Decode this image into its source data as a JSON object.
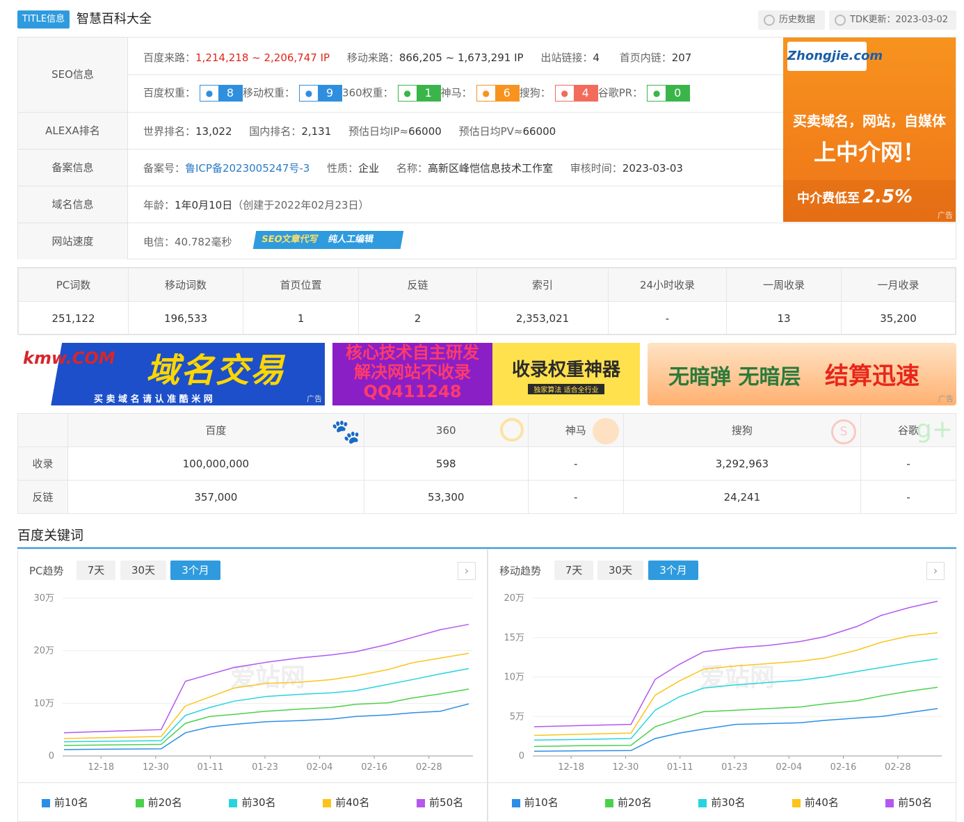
{
  "header": {
    "tag": "TITLE信息",
    "site_name": "智慧百科大全",
    "history_label": "历史数据",
    "tdk_label": "TDK更新：2023-03-02"
  },
  "seo": {
    "row_labels": [
      "SEO信息",
      "ALEXA排名",
      "备案信息",
      "域名信息",
      "网站速度"
    ],
    "baidu_source_k": "百度来路：",
    "baidu_source_v": "1,214,218 ~ 2,206,747 IP",
    "mobile_source_k": "移动来路：",
    "mobile_source_v": "866,205 ~ 1,673,291 IP",
    "out_links_k": "出站链接：",
    "out_links_v": "4",
    "home_links_k": "首页内链：",
    "home_links_v": "207",
    "weights": [
      {
        "k": "百度权重：",
        "v": "8",
        "icon": "paw-icon",
        "color": "#2f8fde"
      },
      {
        "k": "移动权重：",
        "v": "9",
        "icon": "paw-icon",
        "color": "#2f8fde"
      },
      {
        "k": "360权重：",
        "v": "1",
        "icon": "360-icon",
        "color": "#3ab54a"
      },
      {
        "k": "神马：",
        "v": "6",
        "icon": "shenma-icon",
        "color": "#f7931e"
      },
      {
        "k": "搜狗：",
        "v": "4",
        "icon": "sogou-icon",
        "color": "#f26b5b"
      },
      {
        "k": "谷歌PR：",
        "v": "0",
        "icon": "google-plus-icon",
        "color": "#3ab54a"
      }
    ],
    "alexa": {
      "world_k": "世界排名：",
      "world_v": "13,022",
      "cn_k": "国内排名：",
      "cn_v": "2,131",
      "ip_k": "预估日均IP≈",
      "ip_v": "66000",
      "pv_k": "预估日均PV≈",
      "pv_v": "66000"
    },
    "icp": {
      "no_k": "备案号：",
      "no_v": "鲁ICP备2023005247号-3",
      "type_k": "性质：",
      "type_v": "企业",
      "name_k": "名称：",
      "name_v": "高新区峰恺信息技术工作室",
      "date_k": "审核时间：",
      "date_v": "2023-03-03"
    },
    "domain": {
      "age_k": "年龄：",
      "age_v": "1年0月10日",
      "created": "（创建于2022年02月23日）"
    },
    "speed": {
      "k": "电信：",
      "v": "40.782毫秒",
      "promo_a": "SEO文章代写",
      "promo_b": "纯人工编辑"
    }
  },
  "ad_zhongjie": {
    "logo": "Zhongjie.com",
    "logo_cn": "中介网",
    "line1": "买卖域名，网站，自媒体",
    "line2": "上中介网！",
    "line3": "中介费低至",
    "pct": "2.5%",
    "ad_tag": "广告"
  },
  "stats": {
    "headers": [
      "PC词数",
      "移动词数",
      "首页位置",
      "反链",
      "索引",
      "24小时收录",
      "一周收录",
      "一月收录"
    ],
    "values": [
      "251,122",
      "196,533",
      "1",
      "2",
      "2,353,021",
      "-",
      "13",
      "35,200"
    ]
  },
  "banners": {
    "kmw_logo": "kmw.COM",
    "kmw_cn": "酷米网",
    "kmw_title": "域名交易",
    "kmw_sub": "买 卖 域 名 请 认 准 酷 米 网",
    "b2_line1": "核心技术自主研发",
    "b2_line2": "解决网站不收录",
    "b2_line3": "QQ411248",
    "b2_title": "收录权重神器",
    "b2_sub": "独家算法 适合全行业",
    "b3_text1": "无暗弹 无暗层",
    "b3_text2": "结算迅速",
    "ad_tag": "广告"
  },
  "engines": {
    "headers": [
      "百度",
      "360",
      "神马",
      "搜狗",
      "谷歌"
    ],
    "rows": [
      {
        "label": "收录",
        "values": [
          "100,000,000",
          "598",
          "-",
          "3,292,963",
          "-"
        ]
      },
      {
        "label": "反链",
        "values": [
          "357,000",
          "53,300",
          "-",
          "24,241",
          "-"
        ]
      }
    ]
  },
  "keywords": {
    "section_title": "百度关键词",
    "tabs": [
      "7天",
      "30天",
      "3个月"
    ],
    "active_tab": "3个月",
    "pc_title": "PC趋势",
    "mobile_title": "移动趋势",
    "watermark": "爱站网",
    "legend": [
      "前10名",
      "前20名",
      "前30名",
      "前40名",
      "前50名"
    ],
    "legend_colors": [
      "#2b8ee6",
      "#4cd04c",
      "#26d4e0",
      "#fcc419",
      "#b457ef"
    ]
  },
  "chart_data": [
    {
      "type": "line",
      "title": "PC趋势",
      "x": [
        "12-18",
        "12-30",
        "01-11",
        "01-23",
        "02-04",
        "02-16",
        "02-28"
      ],
      "yticks": [
        "0",
        "10万",
        "20万",
        "30万"
      ],
      "ylim": [
        0,
        300000
      ],
      "series": [
        {
          "name": "前10名",
          "color": "#2b8ee6",
          "values": [
            12000,
            13000,
            13500,
            44000,
            55000,
            60000,
            65000,
            67000,
            70000,
            75000,
            78000,
            82000,
            85000,
            99000
          ]
        },
        {
          "name": "前20名",
          "color": "#4cd04c",
          "values": [
            20000,
            21000,
            22000,
            62000,
            75000,
            79000,
            85000,
            89000,
            92000,
            98000,
            101000,
            110000,
            118000,
            127000
          ]
        },
        {
          "name": "前30名",
          "color": "#26d4e0",
          "values": [
            27000,
            28000,
            29000,
            77000,
            92000,
            104000,
            113000,
            117000,
            120000,
            124000,
            136000,
            145000,
            156000,
            166000
          ]
        },
        {
          "name": "前40名",
          "color": "#fcc419",
          "values": [
            33000,
            35000,
            37000,
            95000,
            112000,
            129000,
            138000,
            140000,
            145000,
            152000,
            164000,
            177000,
            186000,
            195000
          ]
        },
        {
          "name": "前50名",
          "color": "#b457ef",
          "values": [
            44000,
            47000,
            50000,
            142000,
            155000,
            168000,
            178000,
            186000,
            192000,
            198000,
            212000,
            225000,
            240000,
            250000
          ]
        }
      ]
    },
    {
      "type": "line",
      "title": "移动趋势",
      "x": [
        "12-18",
        "12-30",
        "01-11",
        "01-23",
        "02-04",
        "02-16",
        "02-28"
      ],
      "yticks": [
        "0",
        "5万",
        "10万",
        "15万",
        "20万"
      ],
      "ylim": [
        0,
        200000
      ],
      "series": [
        {
          "name": "前10名",
          "color": "#2b8ee6",
          "values": [
            6000,
            6500,
            6800,
            22000,
            29000,
            34000,
            40000,
            41000,
            42000,
            45000,
            48000,
            50000,
            55000,
            60000
          ]
        },
        {
          "name": "前20名",
          "color": "#4cd04c",
          "values": [
            12000,
            13000,
            13500,
            37000,
            47000,
            56000,
            58000,
            60000,
            62000,
            66000,
            70000,
            76000,
            82000,
            87000
          ]
        },
        {
          "name": "前30名",
          "color": "#26d4e0",
          "values": [
            20000,
            21000,
            22000,
            58000,
            75000,
            86000,
            90000,
            93000,
            96000,
            100000,
            107000,
            112000,
            118000,
            123000
          ]
        },
        {
          "name": "前40名",
          "color": "#fcc419",
          "values": [
            26000,
            27500,
            29000,
            77000,
            95000,
            110000,
            114000,
            117000,
            120000,
            124000,
            134000,
            144000,
            152000,
            156000
          ]
        },
        {
          "name": "前50名",
          "color": "#b457ef",
          "values": [
            37000,
            38500,
            40000,
            97000,
            116000,
            132000,
            137000,
            140000,
            145000,
            151000,
            164000,
            178000,
            188000,
            196000
          ]
        }
      ]
    }
  ]
}
